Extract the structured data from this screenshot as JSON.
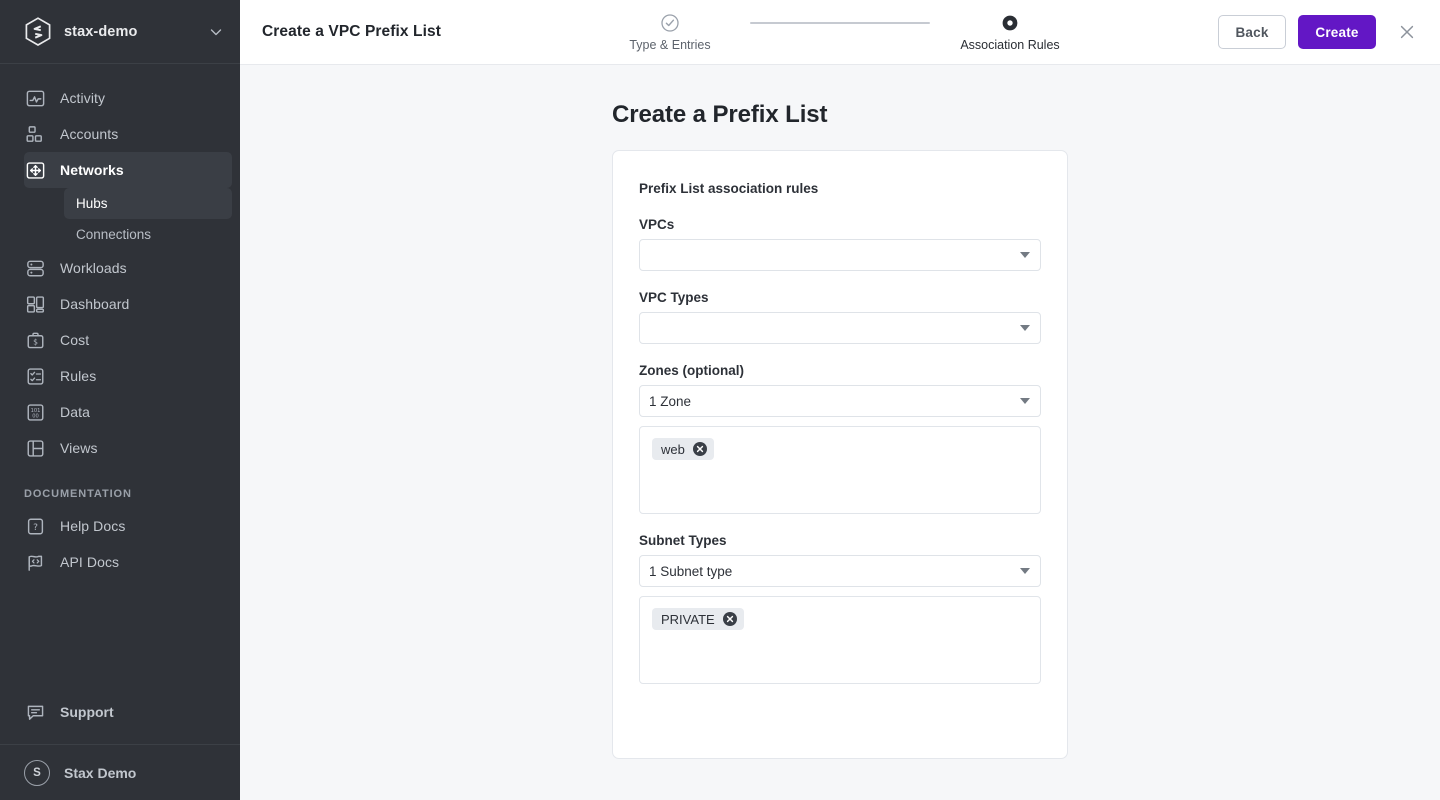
{
  "sidebar": {
    "org": {
      "name": "stax-demo",
      "logo_icon": "stax-hexagon-logo",
      "caret_icon": "chevron-down-icon"
    },
    "items": [
      {
        "label": "Activity",
        "icon": "activity-icon",
        "active": false
      },
      {
        "label": "Accounts",
        "icon": "accounts-icon",
        "active": false
      },
      {
        "label": "Networks",
        "icon": "networks-icon",
        "active": true
      },
      {
        "label": "Workloads",
        "icon": "workloads-icon",
        "active": false
      },
      {
        "label": "Dashboard",
        "icon": "dashboard-icon",
        "active": false
      },
      {
        "label": "Cost",
        "icon": "cost-icon",
        "active": false
      },
      {
        "label": "Rules",
        "icon": "rules-icon",
        "active": false
      },
      {
        "label": "Data",
        "icon": "data-icon",
        "active": false
      },
      {
        "label": "Views",
        "icon": "views-icon",
        "active": false
      }
    ],
    "sub_items": [
      {
        "label": "Hubs",
        "active": true
      },
      {
        "label": "Connections",
        "active": false
      }
    ],
    "documentation_title": "DOCUMENTATION",
    "documentation_items": [
      {
        "label": "Help Docs",
        "icon": "question-mark-icon"
      },
      {
        "label": "API Docs",
        "icon": "code-flag-icon"
      }
    ],
    "support": {
      "label": "Support",
      "icon": "chat-bubble-icon"
    },
    "user": {
      "name": "Stax Demo",
      "initial": "S"
    }
  },
  "topbar": {
    "title": "Create a VPC Prefix List",
    "steps": [
      {
        "label": "Type & Entries",
        "state": "complete",
        "icon": "check-circle-icon"
      },
      {
        "label": "Association Rules",
        "state": "current",
        "icon": "filled-ring-icon"
      }
    ],
    "back_label": "Back",
    "create_label": "Create",
    "close_icon": "close-icon"
  },
  "page": {
    "title": "Create a Prefix List",
    "card_heading": "Prefix List association rules",
    "fields": [
      {
        "label": "VPCs",
        "value": "",
        "caret_icon": "triangle-down-icon",
        "chips": null
      },
      {
        "label": "VPC Types",
        "value": "",
        "caret_icon": "triangle-down-icon",
        "chips": null
      },
      {
        "label": "Zones (optional)",
        "value": "1 Zone",
        "caret_icon": "triangle-down-icon",
        "chips": [
          "web"
        ]
      },
      {
        "label": "Subnet Types",
        "value": "1 Subnet type",
        "caret_icon": "triangle-down-icon",
        "chips": [
          "PRIVATE"
        ]
      }
    ]
  },
  "colors": {
    "sidebar_bg": "#2f3238",
    "sidebar_active": "#3a3e45",
    "accent_purple": "#6317c5",
    "page_bg": "#f6f7f9",
    "card_border": "#e4e7ec",
    "chip_bg": "#e8ebef"
  }
}
